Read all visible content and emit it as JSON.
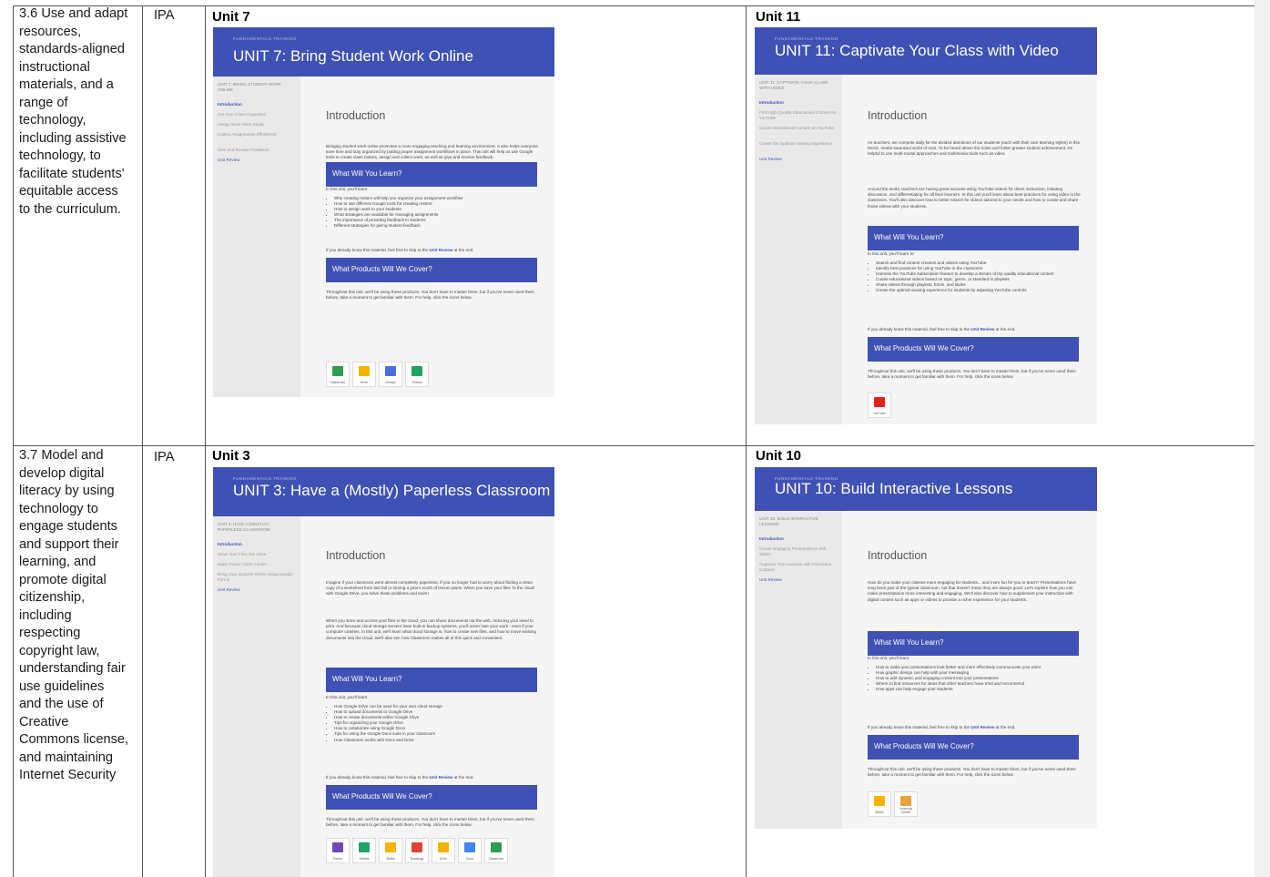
{
  "rows": [
    {
      "standard": [
        "3.6 Use and adapt",
        "resources,",
        "standards-aligned",
        "instructional",
        "materials, and a",
        "range of",
        "technology,",
        "including assistive",
        "technology, to",
        "facilitate students'",
        "equitable access",
        "to the curriculum."
      ],
      "source": "IPA",
      "units": [
        {
          "heading": "Unit 7",
          "kicker": "FUNDAMENTALS TRAINING",
          "title": "UNIT 7: Bring Student Work Online",
          "sidebar_head": "UNIT 7: BRING STUDENT WORK ONLINE",
          "sidebar": [
            "Introduction",
            "Get Your Class Organized",
            "Assign Work More Easily",
            "Collect Assignments Effortlessly",
            "Give and Review Feedback",
            "Unit Review"
          ],
          "intro": "Introduction",
          "paragraphs": [
            "Bringing student work online promotes a more engaging teaching and learning environment. It also helps everyone save time and stay organized by putting proper assignment workflows in place. This unit will help us use Google tools to create class rosters, assign and collect work, as well as give and receive feedback."
          ],
          "learn_heading": "What Will You Learn?",
          "learn_lead": "In this unit, you'll learn:",
          "learn_items": [
            "Why creating rosters will help you organize your assignment workflow",
            "How to use different Google tools for creating rosters",
            "How to assign work to your students",
            "What strategies are available for managing assignments",
            "The importance of providing feedback to students",
            "Different strategies for giving student feedback"
          ],
          "skip_text": "If you already know this material, feel free to skip to the",
          "skip_link": "Unit Review",
          "skip_tail": "at the end.",
          "products_heading": "What Products Will We Cover?",
          "products_text": "Throughout this unit, we'll be using these products. You don't have to master them, but if you've never used them before, take a moment to get familiar with them. For help, click the icons below.",
          "products": [
            {
              "label": "Classroom",
              "color": "#2e9e4f"
            },
            {
              "label": "Drive",
              "color": "#f4b400"
            },
            {
              "label": "Groups",
              "color": "#4a6fd9"
            },
            {
              "label": "Sheets",
              "color": "#1fa463"
            }
          ]
        },
        {
          "heading": "Unit 11",
          "kicker": "FUNDAMENTALS TRAINING",
          "title": "UNIT 11: Captivate Your Class with Video",
          "sidebar_head": "UNIT 11: CAPTIVATE YOUR CLASS WITH VIDEO",
          "sidebar": [
            "Introduction",
            "Find High-Quality Educational Content on YouTube",
            "Curate Educational Content on YouTube",
            "Create the Optimal Viewing Experience",
            "Unit Review"
          ],
          "intro": "Introduction",
          "paragraphs": [
            "As teachers, we compete daily for the divided attentions of our students (each with their own learning styles) in this hectic, media-saturated world of ours. To be heard above the noise and foster greater student achievement, it's helpful to use multi-modal approaches and multimedia tools such as video.",
            "Around the world, teachers are having great success using YouTube videos for direct instruction, initiating discussion, and differentiating for all their learners. In this unit you'll learn about best practices for using video in the classroom. You'll also discover how to better search for videos tailored to your needs and how to curate and share those videos with your students."
          ],
          "learn_heading": "What Will You Learn?",
          "learn_lead": "In this unit, you'll learn to:",
          "learn_items": [
            "Search and find content creators and videos using YouTube",
            "Identify best practices for using YouTube in the classroom",
            "Harness the YouTube subscription feature to develop a stream of top quality educational content",
            "Curate educational videos based on topic, genre, or standard in playlists",
            "Share videos through playlists, forms, and slides",
            "Create the optimal viewing experience for students by adjusting YouTube controls"
          ],
          "skip_text": "If you already know this material, feel free to skip to the",
          "skip_link": "Unit Review",
          "skip_tail": "at the end.",
          "products_heading": "What Products Will We Cover?",
          "products_text": "Throughout this unit, we'll be using these products. You don't have to master them, but if you've never used them before, take a moment to get familiar with them. For help, click the icons below.",
          "products": [
            {
              "label": "YouTube",
              "color": "#e62117"
            }
          ]
        }
      ]
    },
    {
      "standard": [
        "3.7 Model and",
        "develop digital",
        "literacy by using",
        "technology to",
        "engage students",
        "and support their",
        "learning, and",
        "promote digital",
        "citizenship,",
        "including",
        "respecting",
        "copyright law,",
        "understanding fair",
        "use guidelines",
        "and the use of",
        "Creative",
        "Commons license,",
        "and maintaining",
        "Internet Security"
      ],
      "source": "IPA",
      "units": [
        {
          "heading": "Unit 3",
          "kicker": "FUNDAMENTALS TRAINING",
          "title": "UNIT 3: Have a (Mostly) Paperless Classroom",
          "sidebar_head": "UNIT 3: HAVE A (MOSTLY) PAPERLESS CLASSROOM",
          "sidebar": [
            "Introduction",
            "Move Your Files into Drive",
            "Make Fewer Class Copies",
            "Bring Your Quizzes Online Using Google Forms",
            "Unit Review"
          ],
          "intro": "Introduction",
          "paragraphs": [
            "Imagine if your classroom went almost completely paperless. If you no longer had to worry about finding a clean copy of a worksheet from last fall or storing a year's worth of lesson plans. When you save your files 'in the cloud' with Google Drive, you solve these problems and more!",
            "When you store and access your files in the cloud, you can share documents via the web, reducing your need to print. And because cloud storage servers have built-in backup systems, you'll never lose your work - even if your computer crashes. In this unit, we'll learn what cloud storage is, how to create new files, and how to move existing documents into the cloud. We'll also see how Classroom makes all of this quick and convenient."
          ],
          "learn_heading": "What Will You Learn?",
          "learn_lead": "In this unit, you'll learn:",
          "learn_items": [
            "How Google Drive can be used for your own cloud storage",
            "How to upload documents to Google Drive",
            "How to create documents within Google Drive",
            "Tips for organizing your Google Drive",
            "How to collaborate using Google Docs",
            "Tips for using the Google Docs suite in your classroom",
            "How Classroom works with Docs and Drive"
          ],
          "skip_text": "If you already know this material, feel free to skip to the",
          "skip_link": "Unit Review",
          "skip_tail": "at the end.",
          "products_heading": "What Products Will We Cover?",
          "products_text": "Throughout this unit, we'll be using these products. You don't have to master them, but if you've never used them before, take a moment to get familiar with them. For help, click the icons below.",
          "products": [
            {
              "label": "Forms",
              "color": "#7248b9"
            },
            {
              "label": "Sheets",
              "color": "#1fa463"
            },
            {
              "label": "Slides",
              "color": "#f4b400"
            },
            {
              "label": "Drawings",
              "color": "#db4437"
            },
            {
              "label": "Drive",
              "color": "#f4b400"
            },
            {
              "label": "Docs",
              "color": "#4285f4"
            },
            {
              "label": "Classroom",
              "color": "#2e9e4f"
            }
          ]
        },
        {
          "heading": "Unit 10",
          "kicker": "FUNDAMENTALS TRAINING",
          "title": "UNIT 10: Build Interactive Lessons",
          "sidebar_head": "UNIT 10: BUILD INTERACTIVE LESSONS",
          "sidebar": [
            "Introduction",
            "Create Engaging Presentations with Slides",
            "Augment Your Lessons with Interactive Content",
            "Unit Review"
          ],
          "intro": "Introduction",
          "paragraphs": [
            "How do you make your classes more engaging for students... and more fun for you to teach? Presentations have long been part of the typical classroom, but that doesn't mean they are always good. Let's explore how you can make presentations more interesting and engaging. We'll also discover how to supplement your instruction with digital content such as apps or videos to provide a richer experience for your students."
          ],
          "learn_heading": "What Will You Learn?",
          "learn_lead": "In this unit, you'll learn:",
          "learn_items": [
            "How to make your presentations look better and more effectively communicate your point",
            "How graphic design can help with your messaging",
            "How to add dynamic and engaging content into your presentations",
            "Where to find resources for ideas that other teachers have tried and recommend",
            "How apps can help engage your students"
          ],
          "skip_text": "If you already know this material, feel free to skip to the",
          "skip_link": "Unit Review",
          "skip_tail": "at the end.",
          "products_heading": "What Products Will We Cover?",
          "products_text": "Throughout this unit, we'll be using these products. You don't have to master them, but if you've never used them before, take a moment to get familiar with them. For help, click the icons below.",
          "products": [
            {
              "label": "Slides",
              "color": "#f4b400"
            },
            {
              "label": "Learning Center",
              "color": "#e8a33d"
            }
          ]
        }
      ]
    }
  ]
}
